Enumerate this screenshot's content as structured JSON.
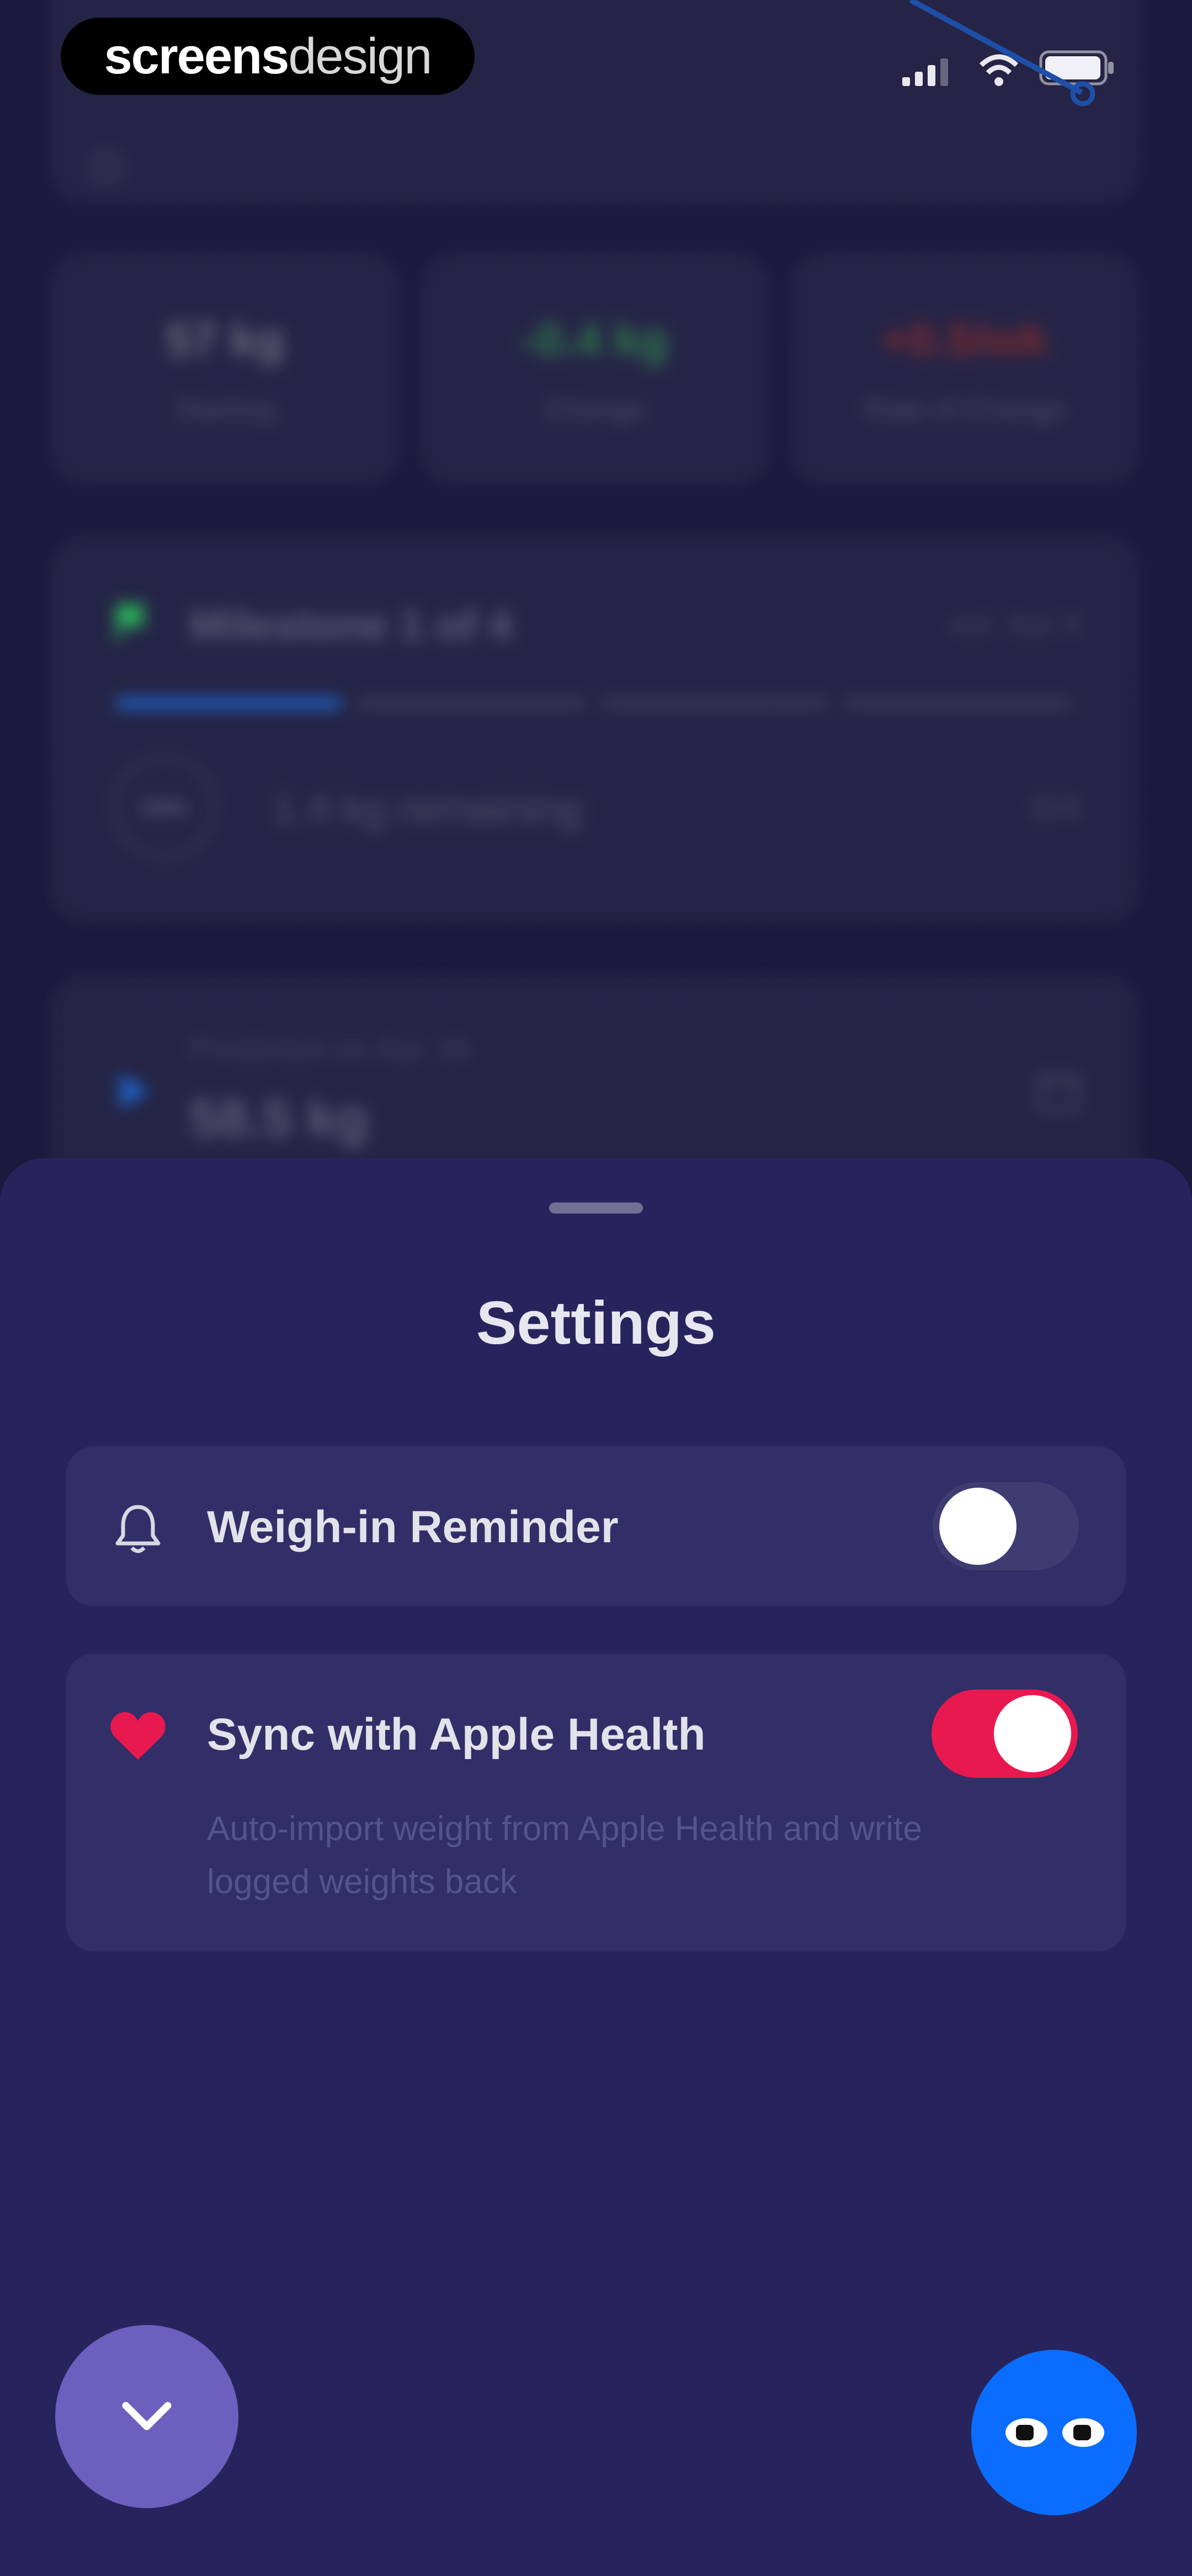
{
  "branding": {
    "logo_bold": "screens",
    "logo_light": "design"
  },
  "status_bar": {
    "signal_icon": "signal-bars-icon",
    "wifi_icon": "wifi-icon",
    "battery_icon": "battery-icon"
  },
  "background": {
    "stats": [
      {
        "value": "57 kg",
        "label": "Starting",
        "color": "#6a6a7e"
      },
      {
        "value": "-0.4 kg",
        "label": "Change",
        "color": "#2f7a4b"
      },
      {
        "value": "+0.5/wk",
        "label": "Rate of Change",
        "color": "#7b2a2e"
      }
    ],
    "milestone": {
      "title": "Milestone 1 of 4",
      "est": "est. Apr 8",
      "percent": "23%",
      "progress_fraction": 0.23,
      "remaining": "1.4 kg remaining",
      "count": "0/4",
      "flag_color": "#2bb35a",
      "accent": "#1e63c6"
    },
    "prediction": {
      "caption": "Predicted on Apr 16",
      "value": "58.5 kg"
    }
  },
  "settings": {
    "title": "Settings",
    "reminder": {
      "label": "Weigh-in Reminder",
      "icon": "bell-icon",
      "enabled": false
    },
    "health": {
      "label": "Sync with Apple Health",
      "icon": "heart-icon",
      "description_line1": "Auto-import weight from Apple Health and write",
      "description_line2": "logged weights back",
      "enabled": true,
      "accent": "#e8194f"
    }
  },
  "fabs": {
    "collapse_icon": "chevron-down-icon",
    "assistant_icon": "eyes-icon"
  }
}
